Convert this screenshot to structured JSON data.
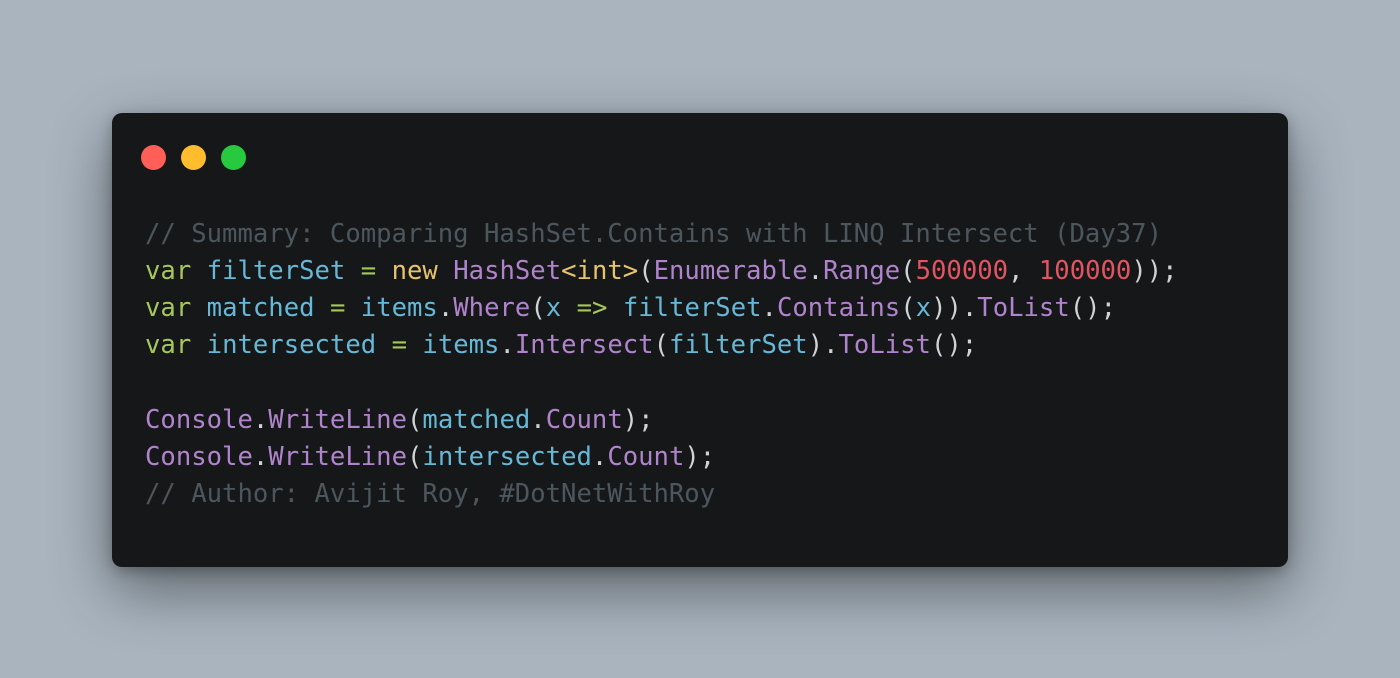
{
  "window": {
    "controls": [
      {
        "name": "close",
        "color": "#ff5f56"
      },
      {
        "name": "minimize",
        "color": "#ffbd2e"
      },
      {
        "name": "zoom",
        "color": "#27c93f"
      }
    ]
  },
  "code": {
    "language": "csharp",
    "lines": [
      {
        "tokens": [
          {
            "t": "// Summary: Comparing HashSet.Contains with LINQ Intersect (Day37)",
            "k": "comment"
          }
        ]
      },
      {
        "tokens": [
          {
            "t": "var",
            "k": "keyword"
          },
          {
            "t": " ",
            "k": "punc"
          },
          {
            "t": "filterSet",
            "k": "var"
          },
          {
            "t": " ",
            "k": "punc"
          },
          {
            "t": "=",
            "k": "op"
          },
          {
            "t": " ",
            "k": "punc"
          },
          {
            "t": "new",
            "k": "new"
          },
          {
            "t": " ",
            "k": "punc"
          },
          {
            "t": "HashSet",
            "k": "type"
          },
          {
            "t": "<int>",
            "k": "new"
          },
          {
            "t": "(",
            "k": "punc"
          },
          {
            "t": "Enumerable",
            "k": "type"
          },
          {
            "t": ".",
            "k": "punc"
          },
          {
            "t": "Range",
            "k": "method"
          },
          {
            "t": "(",
            "k": "punc"
          },
          {
            "t": "500000",
            "k": "num"
          },
          {
            "t": ", ",
            "k": "punc"
          },
          {
            "t": "100000",
            "k": "num"
          },
          {
            "t": "));",
            "k": "punc"
          }
        ]
      },
      {
        "tokens": [
          {
            "t": "var",
            "k": "keyword"
          },
          {
            "t": " ",
            "k": "punc"
          },
          {
            "t": "matched",
            "k": "var"
          },
          {
            "t": " ",
            "k": "punc"
          },
          {
            "t": "=",
            "k": "op"
          },
          {
            "t": " ",
            "k": "punc"
          },
          {
            "t": "items",
            "k": "var"
          },
          {
            "t": ".",
            "k": "punc"
          },
          {
            "t": "Where",
            "k": "method"
          },
          {
            "t": "(",
            "k": "punc"
          },
          {
            "t": "x",
            "k": "var"
          },
          {
            "t": " ",
            "k": "punc"
          },
          {
            "t": "=>",
            "k": "op"
          },
          {
            "t": " ",
            "k": "punc"
          },
          {
            "t": "filterSet",
            "k": "var"
          },
          {
            "t": ".",
            "k": "punc"
          },
          {
            "t": "Contains",
            "k": "method"
          },
          {
            "t": "(",
            "k": "punc"
          },
          {
            "t": "x",
            "k": "var"
          },
          {
            "t": ")).",
            "k": "punc"
          },
          {
            "t": "ToList",
            "k": "method"
          },
          {
            "t": "();",
            "k": "punc"
          }
        ]
      },
      {
        "tokens": [
          {
            "t": "var",
            "k": "keyword"
          },
          {
            "t": " ",
            "k": "punc"
          },
          {
            "t": "intersected",
            "k": "var"
          },
          {
            "t": " ",
            "k": "punc"
          },
          {
            "t": "=",
            "k": "op"
          },
          {
            "t": " ",
            "k": "punc"
          },
          {
            "t": "items",
            "k": "var"
          },
          {
            "t": ".",
            "k": "punc"
          },
          {
            "t": "Intersect",
            "k": "method"
          },
          {
            "t": "(",
            "k": "punc"
          },
          {
            "t": "filterSet",
            "k": "var"
          },
          {
            "t": ").",
            "k": "punc"
          },
          {
            "t": "ToList",
            "k": "method"
          },
          {
            "t": "();",
            "k": "punc"
          }
        ]
      },
      {
        "tokens": []
      },
      {
        "tokens": [
          {
            "t": "Console",
            "k": "type"
          },
          {
            "t": ".",
            "k": "punc"
          },
          {
            "t": "WriteLine",
            "k": "method"
          },
          {
            "t": "(",
            "k": "punc"
          },
          {
            "t": "matched",
            "k": "var"
          },
          {
            "t": ".",
            "k": "punc"
          },
          {
            "t": "Count",
            "k": "method"
          },
          {
            "t": ");",
            "k": "punc"
          }
        ]
      },
      {
        "tokens": [
          {
            "t": "Console",
            "k": "type"
          },
          {
            "t": ".",
            "k": "punc"
          },
          {
            "t": "WriteLine",
            "k": "method"
          },
          {
            "t": "(",
            "k": "punc"
          },
          {
            "t": "intersected",
            "k": "var"
          },
          {
            "t": ".",
            "k": "punc"
          },
          {
            "t": "Count",
            "k": "method"
          },
          {
            "t": ");",
            "k": "punc"
          }
        ]
      },
      {
        "tokens": [
          {
            "t": "// Author: Avijit Roy, #DotNetWithRoy",
            "k": "comment"
          }
        ]
      }
    ]
  },
  "colors": {
    "background": "#a9b4bf",
    "window": "#161719",
    "comment": "#4c575d",
    "keyword": "#a6c85a",
    "variable": "#66b8d6",
    "type": "#b084cc",
    "number": "#e05561",
    "new": "#e7c46b"
  }
}
